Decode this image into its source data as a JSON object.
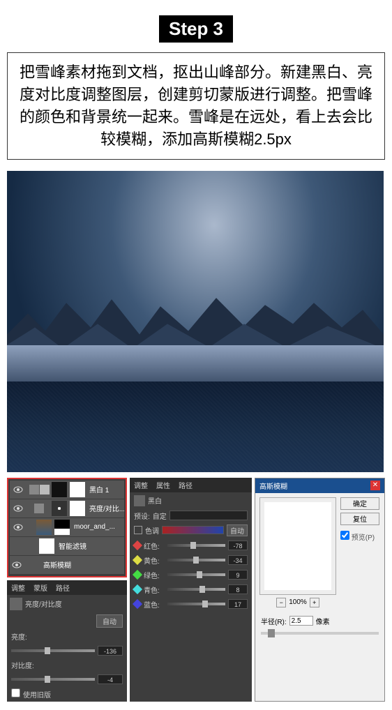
{
  "step_label": "Step 3",
  "description": "把雪峰素材拖到文档，抠出山峰部分。新建黑白、亮度对比度调整图层，创建剪切蒙版进行调整。把雪峰的颜色和背景统一起来。雪峰是在远处，看上去会比较模糊，添加高斯模糊2.5px",
  "layers": {
    "items": [
      {
        "label": "黑白 1"
      },
      {
        "label": "亮度/对比..."
      },
      {
        "label": "moor_and_..."
      },
      {
        "label": "智能滤镜"
      },
      {
        "label": "高斯模糊"
      }
    ]
  },
  "bc_panel": {
    "tabs": [
      "调整",
      "蒙版",
      "路径"
    ],
    "title": "亮度/对比度",
    "auto_btn": "自动",
    "brightness_label": "亮度:",
    "brightness_value": "-136",
    "contrast_label": "对比度:",
    "contrast_value": "-4",
    "legacy_label": "使用旧版"
  },
  "colors_panel": {
    "tabs": [
      "调整",
      "属性",
      "路径"
    ],
    "title": "黑白",
    "preset_label": "预设:",
    "preset_value": "自定",
    "tint_label": "色调",
    "auto_btn": "自动",
    "rows": [
      {
        "label": "红色:",
        "value": "-78",
        "color": "#d44"
      },
      {
        "label": "黄色:",
        "value": "-34",
        "color": "#dd4"
      },
      {
        "label": "绿色:",
        "value": "9",
        "color": "#4d4"
      },
      {
        "label": "青色:",
        "value": "8",
        "color": "#4dd"
      },
      {
        "label": "蓝色:",
        "value": "17",
        "color": "#44d"
      }
    ]
  },
  "gauss": {
    "title": "高斯模糊",
    "ok": "确定",
    "cancel": "复位",
    "preview_chk": "预览(P)",
    "pct": "100%",
    "radius_label": "半径(R):",
    "radius_value": "2.5",
    "unit": "像素"
  }
}
